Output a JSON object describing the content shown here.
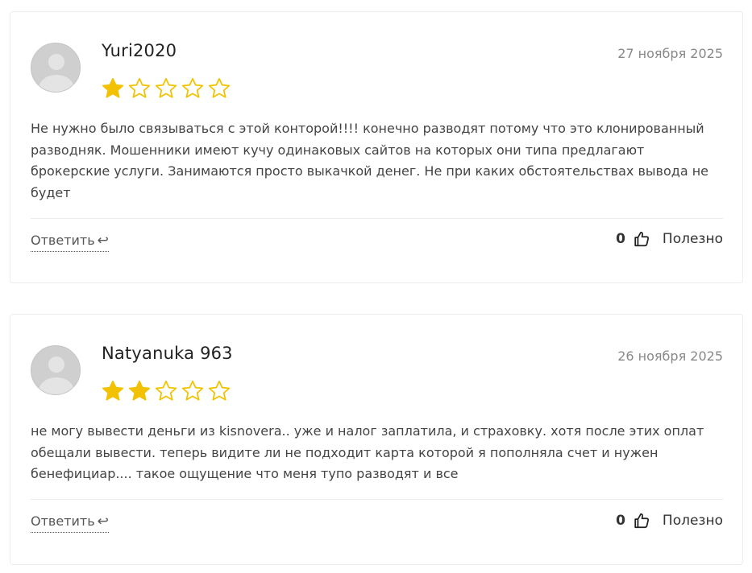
{
  "colors": {
    "star_filled": "#f2c200",
    "star_empty": "#f2c200",
    "border": "#ececec"
  },
  "reviews": [
    {
      "author": "Yuri2020",
      "date": "27 ноября 2025",
      "rating": 1,
      "max_rating": 5,
      "text": "Не нужно было связываться с этой конторой!!!! конечно разводят потому что это клонированный разводняк. Мошенники имеют кучу одинаковых сайтов на которых они типа предлагают брокерские услуги. Занимаются просто выкачкой денег. Не при каких обстоятельствах вывода не будет",
      "reply_label": "Ответить",
      "reply_icon": "↩",
      "likes": "0",
      "helpful_label": "Полезно",
      "avatar_icon": "default-user-avatar",
      "like_icon": "thumbs-up-icon"
    },
    {
      "author": "Natyanuka 963",
      "date": "26 ноября 2025",
      "rating": 2,
      "max_rating": 5,
      "text": "не могу вывести деньги из kisnovera.. уже и налог заплатила, и страховку. хотя после этих оплат обещали вывести. теперь видите ли не подходит карта которой я пополняла счет и нужен бенефициар.... такое ощущение что меня тупо разводят и все",
      "reply_label": "Ответить",
      "reply_icon": "↩",
      "likes": "0",
      "helpful_label": "Полезно",
      "avatar_icon": "default-user-avatar",
      "like_icon": "thumbs-up-icon"
    }
  ]
}
